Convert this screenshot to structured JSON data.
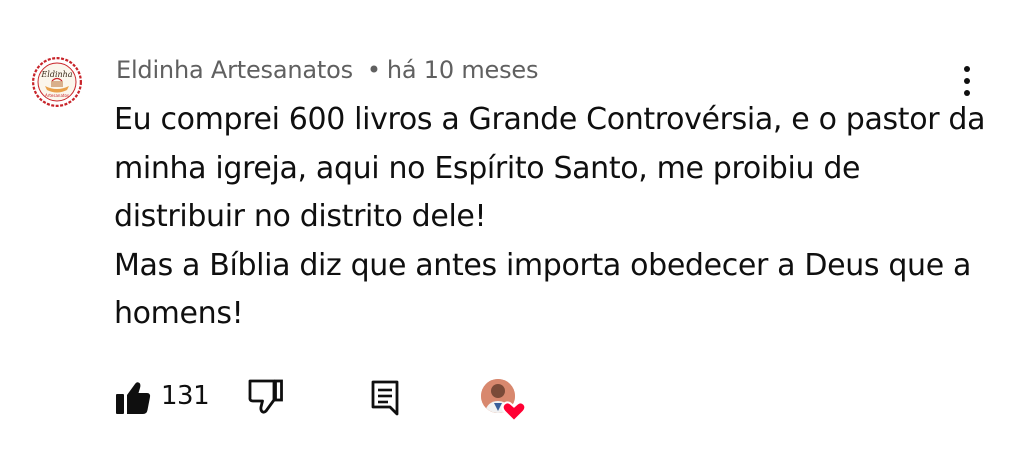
{
  "comment": {
    "author": "Eldinha Artesanatos",
    "separator": "•",
    "time_ago": "há 10 meses",
    "avatar_text": "Eldinha",
    "paragraphs": [
      "Eu comprei 600 livros a Grande Controvérsia, e o pastor da minha igreja, aqui no Espírito Santo, me proibiu de distribuir no distrito dele!",
      "Mas a Bíblia diz que antes importa obedecer a Deus que a homens!"
    ]
  },
  "actions": {
    "like_count": "131",
    "like_icon": "thumbs-up-filled-icon",
    "dislike_icon": "thumbs-down-outline-icon",
    "reply_icon": "reply-comment-icon",
    "heart_icon": "creator-heart-icon"
  },
  "colors": {
    "text_primary": "#0f0f0f",
    "text_secondary": "#606060",
    "heart": "#ff0033",
    "avatar_border": "#c8242a"
  }
}
